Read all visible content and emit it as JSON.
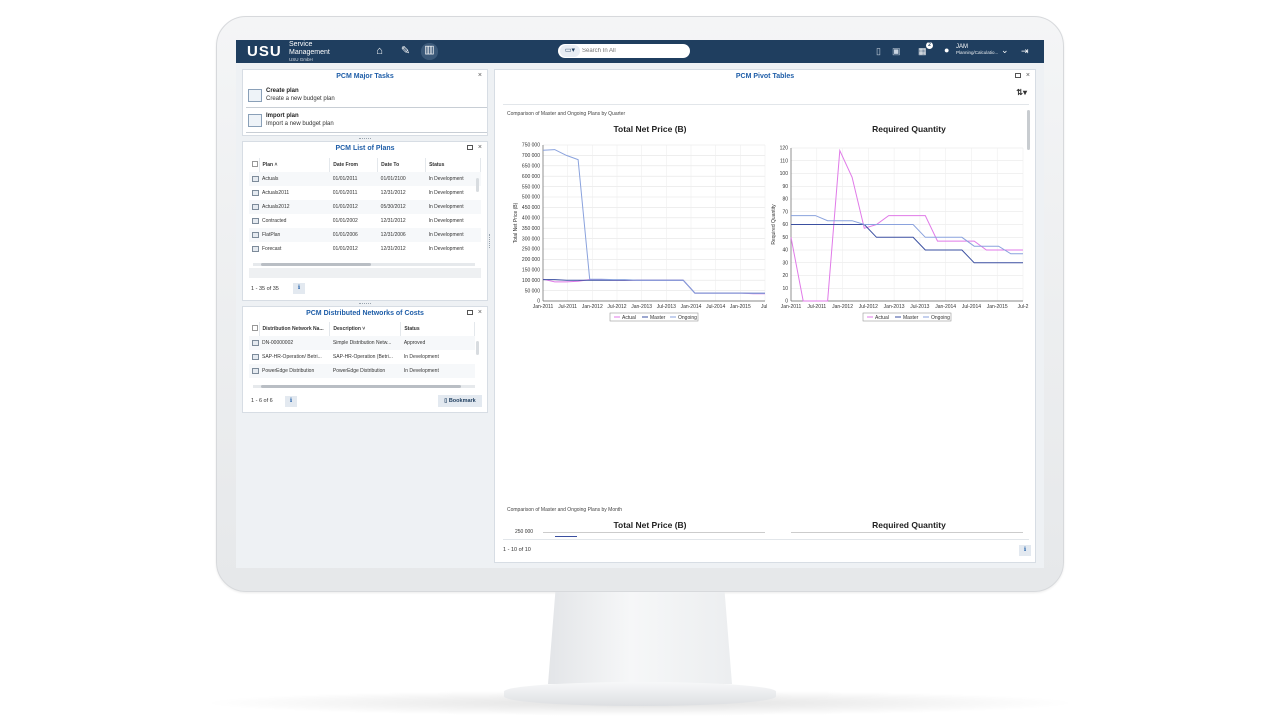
{
  "topbar": {
    "logo": "USU",
    "brand_line1": "Service",
    "brand_line2": "Management",
    "brand_company": "USU GmbH",
    "search_placeholder": "Search In All",
    "notification_count": "2",
    "user_name": "JAM",
    "user_role": "Planning/Calculatio..."
  },
  "major_tasks": {
    "title": "PCM Major Tasks",
    "items": [
      {
        "name": "Create plan",
        "desc": "Create a new budget plan"
      },
      {
        "name": "Import plan",
        "desc": "Import a new budget plan"
      }
    ]
  },
  "plans": {
    "title": "PCM List of Plans",
    "columns": [
      "Plan",
      "Date From",
      "Date To",
      "Status"
    ],
    "rows": [
      [
        "Actuals",
        "01/01/2011",
        "01/01/2100",
        "In Development"
      ],
      [
        "Actuals2011",
        "01/01/2011",
        "12/31/2012",
        "In Development"
      ],
      [
        "Actuals2012",
        "01/01/2012",
        "05/30/2012",
        "In Development"
      ],
      [
        "Contracted",
        "01/01/2002",
        "12/31/2012",
        "In Development"
      ],
      [
        "FlatPlan",
        "01/01/2006",
        "12/31/2006",
        "In Development"
      ],
      [
        "Forecast",
        "01/01/2012",
        "12/31/2012",
        "In Development"
      ]
    ],
    "pager": "1 - 35 of 35"
  },
  "networks": {
    "title": "PCM Distributed Networks of Costs",
    "columns": [
      "Distribution Network Na...",
      "Description",
      "Status"
    ],
    "rows": [
      [
        "DN-00000002",
        "Simple Distribution Netw...",
        "Approved"
      ],
      [
        "SAP-HR-Operation/ Betri...",
        "SAP-HR-Operation (Betri...",
        "In Development"
      ],
      [
        "PowerEdge Distribution",
        "PowerEdge Distribution",
        "In Development"
      ]
    ],
    "pager": "1 - 6 of 6",
    "bookmark_label": "Bookmark"
  },
  "pivot": {
    "title": "PCM Pivot Tables",
    "section1": "Comparison of Master and Ongoing Plans by Quarter",
    "section2": "Comparison of Master and Ongoing Plans by Month",
    "chart1_title": "Total Net Price (B)",
    "chart2_title": "Required Quantity",
    "chart3_title": "Total Net Price (B)",
    "chart4_title": "Required Quantity",
    "chart3_ytick": "250 000",
    "pager": "1 - 10 of 10"
  },
  "colors": {
    "actual": "#e07ae8",
    "master": "#3a4fa0",
    "ongoing": "#8aa2dd",
    "topbar": "#1f3e5f"
  },
  "chart_data": [
    {
      "type": "line",
      "title": "Total Net Price (B)",
      "xlabel": "",
      "ylabel": "Total Net Price (B)",
      "ylim": [
        0,
        750000
      ],
      "yticks": [
        "0",
        "50 000",
        "100 000",
        "150 000",
        "200 000",
        "250 000",
        "300 000",
        "350 000",
        "400 000",
        "450 000",
        "500 000",
        "550 000",
        "600 000",
        "650 000",
        "700 000",
        "750 000"
      ],
      "xticks": [
        "Jan-2011",
        "Jul-2011",
        "Jan-2012",
        "Jul-2012",
        "Jan-2013",
        "Jul-2013",
        "Jan-2014",
        "Jul-2014",
        "Jan-2015",
        "Jul-"
      ],
      "x": [
        0,
        1,
        2,
        3,
        4,
        5,
        6,
        7,
        8,
        9,
        10,
        11,
        12,
        13,
        14,
        15,
        16,
        17,
        18,
        19
      ],
      "series": [
        {
          "name": "Actual",
          "values": [
            105000,
            92000,
            92000,
            95000,
            103000,
            103000,
            100000,
            100000,
            100000,
            100000,
            100000,
            100000,
            100000,
            38000,
            38000,
            38000,
            38000,
            38000,
            35000,
            35000
          ]
        },
        {
          "name": "Master",
          "values": [
            103000,
            103000,
            100000,
            100000,
            100000,
            100000,
            100000,
            100000,
            100000,
            100000,
            100000,
            100000,
            100000,
            38000,
            38000,
            38000,
            38000,
            38000,
            37000,
            37000
          ]
        },
        {
          "name": "Ongoing",
          "values": [
            725000,
            728000,
            700000,
            680000,
            105000,
            105000,
            103000,
            103000,
            100000,
            100000,
            100000,
            100000,
            100000,
            38000,
            38000,
            38000,
            38000,
            38000,
            37000,
            37000
          ]
        }
      ],
      "legend": "bottom"
    },
    {
      "type": "line",
      "title": "Required Quantity",
      "xlabel": "",
      "ylabel": "Required Quantity",
      "ylim": [
        0,
        120
      ],
      "yticks": [
        "0",
        "10",
        "20",
        "30",
        "40",
        "50",
        "60",
        "70",
        "80",
        "90",
        "100",
        "110",
        "120"
      ],
      "xticks": [
        "Jan-2011",
        "Jul-2011",
        "Jan-2012",
        "Jul-2012",
        "Jan-2013",
        "Jul-2013",
        "Jan-2014",
        "Jul-2014",
        "Jan-2015",
        "Jul-2"
      ],
      "x": [
        0,
        1,
        2,
        3,
        4,
        5,
        6,
        7,
        8,
        9,
        10,
        11,
        12,
        13,
        14,
        15,
        16,
        17,
        18,
        19
      ],
      "series": [
        {
          "name": "Actual",
          "values": [
            50,
            0,
            0,
            0,
            118,
            97,
            57,
            60,
            67,
            67,
            67,
            67,
            47,
            47,
            47,
            47,
            40,
            40,
            40,
            40
          ]
        },
        {
          "name": "Master",
          "values": [
            60,
            60,
            60,
            60,
            60,
            60,
            60,
            50,
            50,
            50,
            50,
            40,
            40,
            40,
            40,
            30,
            30,
            30,
            30,
            30
          ]
        },
        {
          "name": "Ongoing",
          "values": [
            67,
            67,
            67,
            63,
            63,
            63,
            60,
            60,
            60,
            60,
            60,
            50,
            50,
            50,
            50,
            43,
            43,
            43,
            37,
            37
          ]
        }
      ],
      "legend": "bottom"
    }
  ]
}
